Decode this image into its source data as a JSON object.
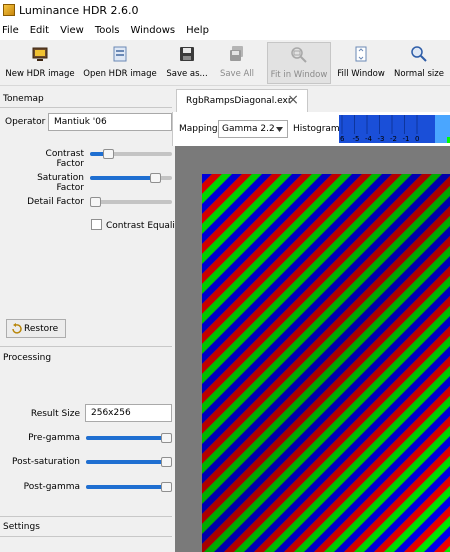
{
  "window": {
    "title": "Luminance HDR 2.6.0"
  },
  "menu": [
    "File",
    "Edit",
    "View",
    "Tools",
    "Windows",
    "Help"
  ],
  "toolbar": {
    "new_hdr": "New HDR image",
    "open_hdr": "Open HDR image",
    "save_as": "Save as...",
    "save_all": "Save All",
    "fit_in_window": "Fit in Window",
    "fill_window": "Fill Window",
    "normal_size": "Normal size"
  },
  "tonemap": {
    "section_title": "Tonemap",
    "operator_label": "Operator",
    "operator_value": "Mantiuk '06",
    "contrast_label": "Contrast Factor",
    "contrast_level": 0.18,
    "saturation_label": "Saturation Factor",
    "saturation_level": 0.85,
    "detail_label": "Detail Factor",
    "detail_level": 0.0,
    "contrast_eq_label": "Contrast Equaliz",
    "contrast_eq_checked": false,
    "restore_label": "Restore"
  },
  "processing": {
    "section_title": "Processing",
    "result_size_label": "Result Size",
    "result_size_value": "256x256",
    "pre_gamma_label": "Pre-gamma",
    "pre_gamma_level": 1.0,
    "post_saturation_label": "Post-saturation",
    "post_saturation_level": 1.0,
    "post_gamma_label": "Post-gamma",
    "post_gamma_level": 1.0
  },
  "settings": {
    "section_title": "Settings"
  },
  "document_tab": {
    "name": "RgbRampsDiagonal.exr"
  },
  "mapping": {
    "label": "Mapping:",
    "value": "Gamma 2.2",
    "histogram_label": "Histogram:",
    "histogram_ticks": [
      "6",
      "-5",
      "-4",
      "-3",
      "-2",
      "-1",
      "0"
    ]
  },
  "colors": {
    "accent": "#1f6fd1",
    "histogram_bg": "#1a4fd8",
    "stripe_red": "#ff0000",
    "stripe_green": "#00ff00",
    "stripe_blue": "#0000ff"
  }
}
